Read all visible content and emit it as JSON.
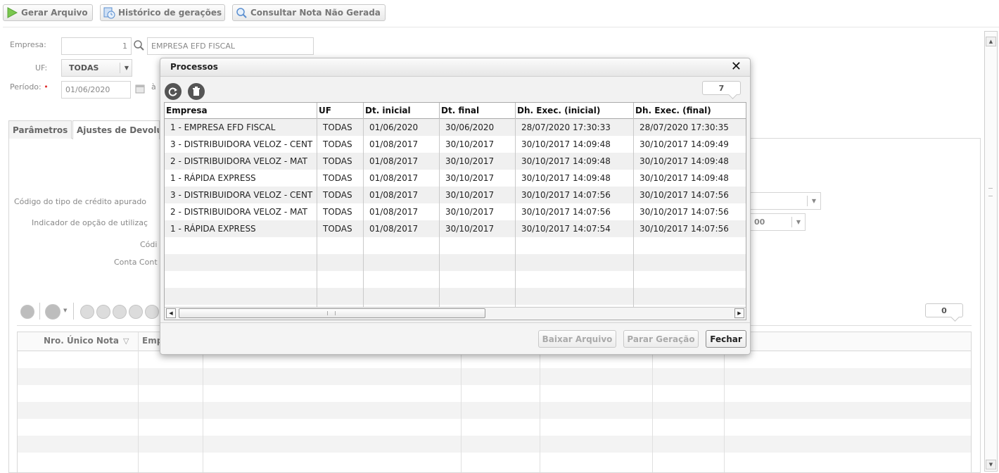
{
  "toolbar": {
    "gerar_arquivo": "Gerar Arquivo",
    "historico": "Histórico de gerações",
    "consultar": "Consultar Nota Não Gerada"
  },
  "form": {
    "empresa_label": "Empresa:",
    "empresa_code": "1",
    "empresa_name": "EMPRESA EFD FISCAL",
    "uf_label": "UF:",
    "uf_value": "TODAS",
    "periodo_label": "Período:",
    "periodo_start": "01/06/2020",
    "periodo_sep": "à"
  },
  "tabs": [
    {
      "label": "Parâmetros"
    },
    {
      "label": "Ajustes de Devolu"
    }
  ],
  "params": {
    "codigo_credito": "Código do tipo de crédito apurado",
    "indicador": "Indicador de opção de utilizaç",
    "codigo": "Códi",
    "conta": "Conta Cont",
    "indicador_value": "00"
  },
  "lower_grid": {
    "count": "0",
    "col_nro": "Nro. Único Nota",
    "col_emp": "Emp"
  },
  "modal": {
    "title": "Processos",
    "close": "✕",
    "count": "7",
    "columns": [
      "Empresa",
      "UF",
      "Dt. inicial",
      "Dt. final",
      "Dh. Exec. (inicial)",
      "Dh. Exec. (final)"
    ],
    "rows": [
      [
        "1 - EMPRESA EFD FISCAL",
        "TODAS",
        "01/06/2020",
        "30/06/2020",
        "28/07/2020 17:30:33",
        "28/07/2020 17:30:35"
      ],
      [
        "3 - DISTRIBUIDORA VELOZ - CENT",
        "TODAS",
        "01/08/2017",
        "30/10/2017",
        "30/10/2017 14:09:48",
        "30/10/2017 14:09:49"
      ],
      [
        "2 - DISTRIBUIDORA VELOZ - MAT",
        "TODAS",
        "01/08/2017",
        "30/10/2017",
        "30/10/2017 14:09:48",
        "30/10/2017 14:09:48"
      ],
      [
        "1 - RÁPIDA EXPRESS",
        "TODAS",
        "01/08/2017",
        "30/10/2017",
        "30/10/2017 14:09:48",
        "30/10/2017 14:09:48"
      ],
      [
        "3 - DISTRIBUIDORA VELOZ - CENT",
        "TODAS",
        "01/08/2017",
        "30/10/2017",
        "30/10/2017 14:07:56",
        "30/10/2017 14:07:56"
      ],
      [
        "2 - DISTRIBUIDORA VELOZ - MAT",
        "TODAS",
        "01/08/2017",
        "30/10/2017",
        "30/10/2017 14:07:56",
        "30/10/2017 14:07:56"
      ],
      [
        "1 - RÁPIDA EXPRESS",
        "TODAS",
        "01/08/2017",
        "30/10/2017",
        "30/10/2017 14:07:54",
        "30/10/2017 14:07:56"
      ]
    ],
    "buttons": {
      "baixar": "Baixar Arquivo",
      "parar": "Parar Geração",
      "fechar": "Fechar"
    }
  }
}
